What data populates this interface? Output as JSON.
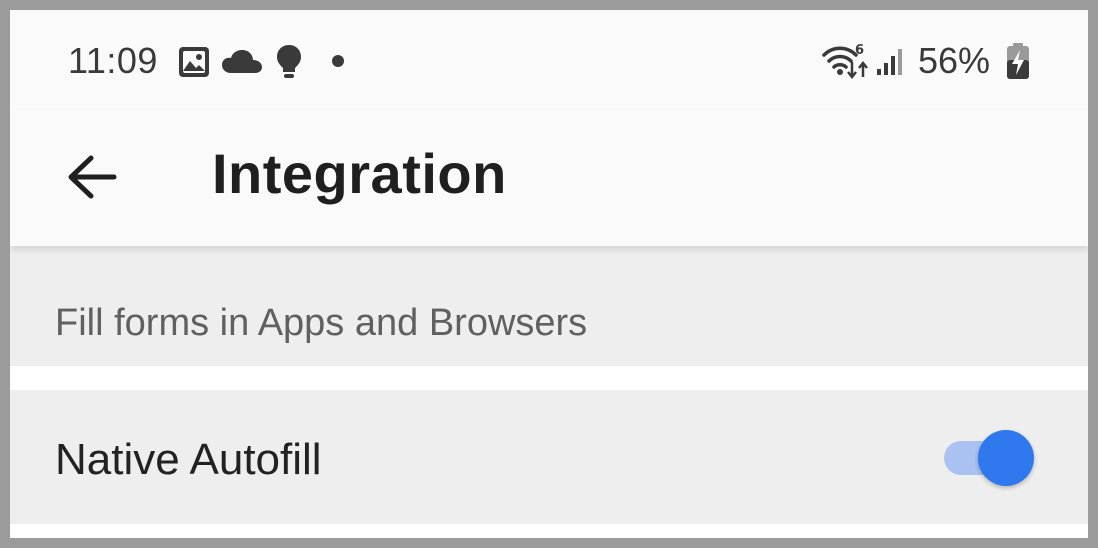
{
  "status_bar": {
    "time": "11:09",
    "notification_icons": [
      "image-icon",
      "cloud-icon",
      "lightbulb-icon",
      "dot-icon"
    ],
    "system_icons": [
      "wifi-6-icon",
      "signal-icon",
      "battery-charging-icon"
    ],
    "battery_percent": "56%"
  },
  "app_bar": {
    "back_icon": "arrow-left-icon",
    "title": "Integration"
  },
  "section": {
    "header": "Fill forms in Apps and Browsers",
    "items": [
      {
        "label": "Native Autofill",
        "toggle_on": true
      }
    ]
  },
  "colors": {
    "accent": "#2f78ee",
    "toggle_track": "#a9c2f2",
    "section_background": "#eeeeee",
    "app_bar_background": "#fafafa"
  }
}
